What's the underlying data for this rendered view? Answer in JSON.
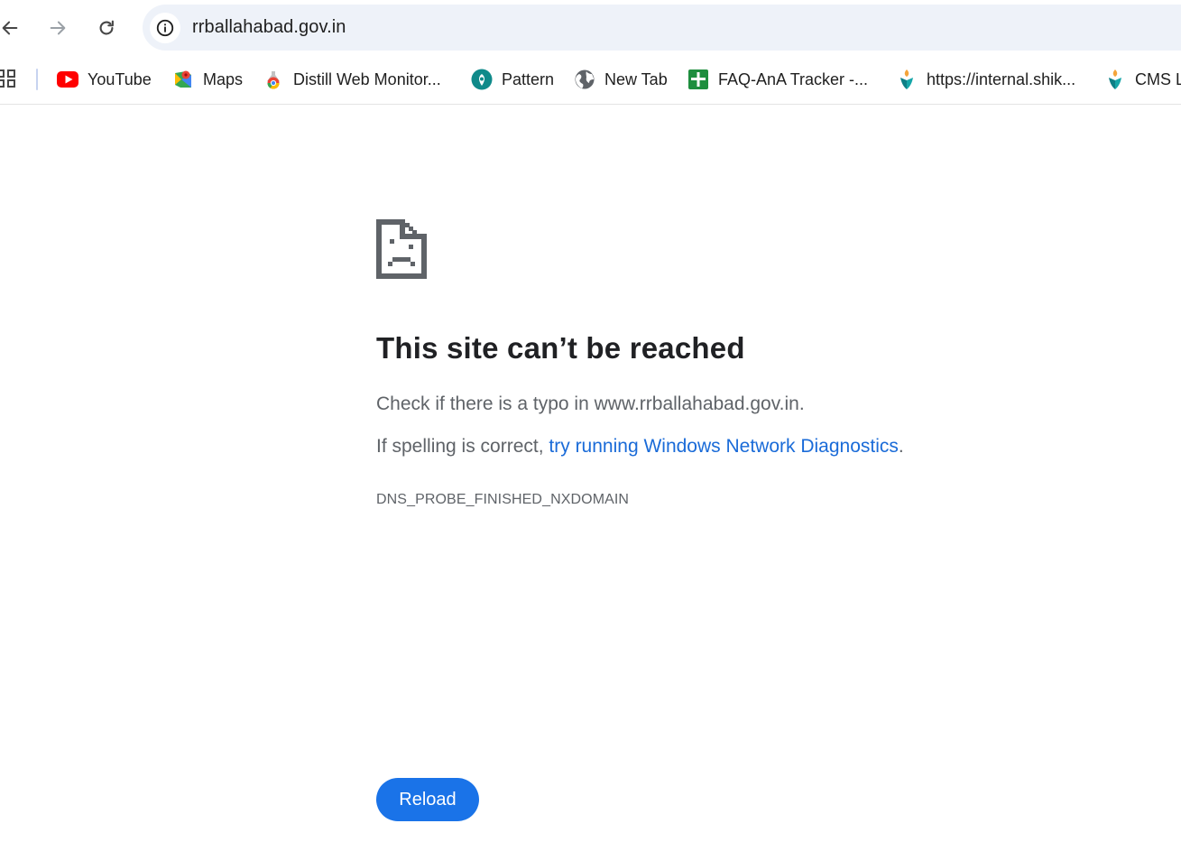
{
  "omnibox": {
    "url": "rrballahabad.gov.in"
  },
  "bookmarks": [
    {
      "label": "YouTube",
      "icon": "youtube-icon"
    },
    {
      "label": "Maps",
      "icon": "maps-icon"
    },
    {
      "label": "Distill Web Monitor...",
      "icon": "distill-icon"
    },
    {
      "label": "Pattern",
      "icon": "pattern-icon"
    },
    {
      "label": "New Tab",
      "icon": "globe-icon"
    },
    {
      "label": "FAQ-AnA Tracker -...",
      "icon": "sheets-icon"
    },
    {
      "label": "https://internal.shik...",
      "icon": "shiksha-icon"
    },
    {
      "label": "CMS L",
      "icon": "shiksha-icon"
    }
  ],
  "error": {
    "title": "This site can’t be reached",
    "line1": "Check if there is a typo in www.rrballahabad.gov.in.",
    "line2_prefix": "If spelling is correct, ",
    "line2_link": "try running Windows Network Diagnostics",
    "line2_suffix": ".",
    "code": "DNS_PROBE_FINISHED_NXDOMAIN",
    "reload_label": "Reload"
  },
  "colors": {
    "link": "#1a6bd8",
    "reload_button": "#1a73e8",
    "omnibox_bg": "#eef2f9"
  }
}
